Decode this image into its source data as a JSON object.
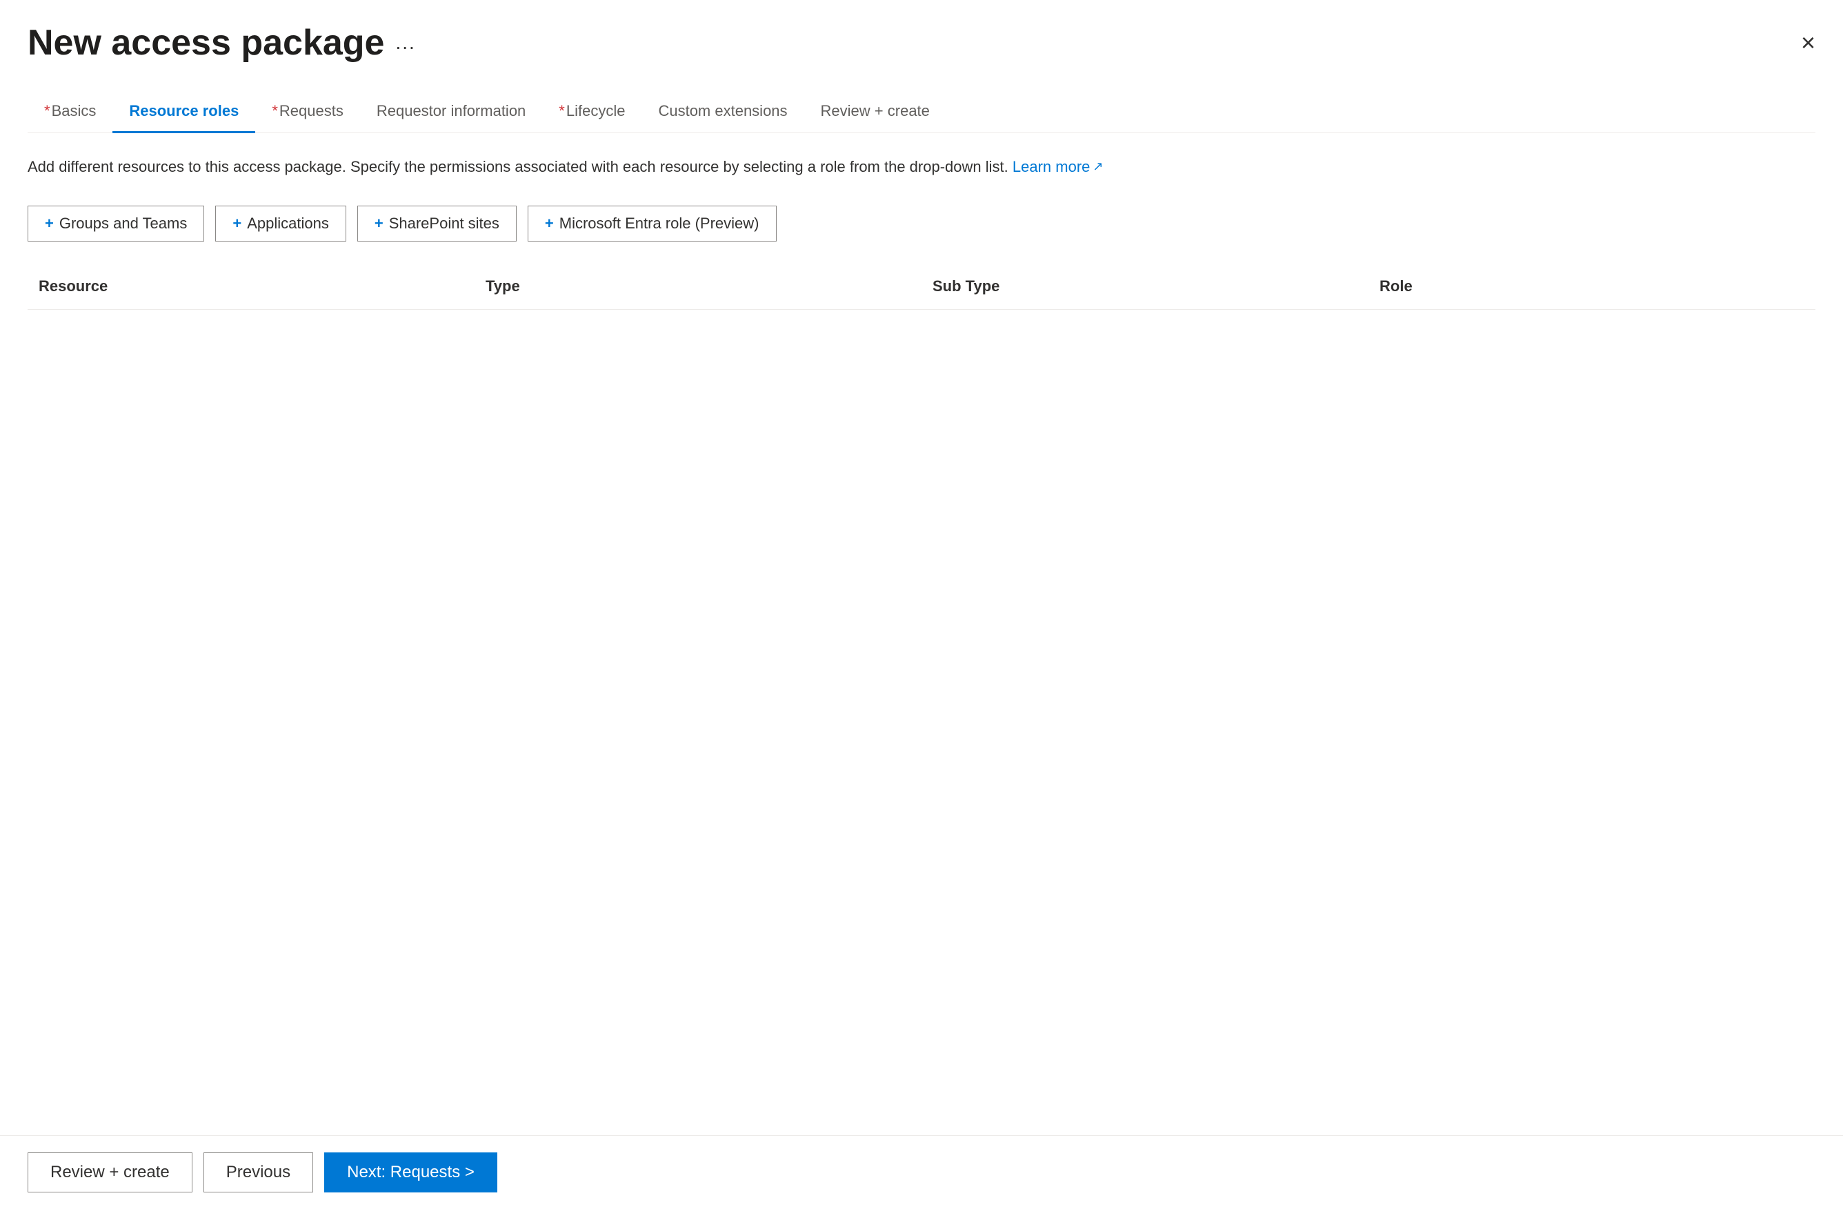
{
  "header": {
    "title": "New access package",
    "more_label": "...",
    "close_label": "×"
  },
  "tabs": [
    {
      "id": "basics",
      "label": "Basics",
      "required": true,
      "active": false
    },
    {
      "id": "resource-roles",
      "label": "Resource roles",
      "required": false,
      "active": true
    },
    {
      "id": "requests",
      "label": "Requests",
      "required": true,
      "active": false
    },
    {
      "id": "requestor-info",
      "label": "Requestor information",
      "required": false,
      "active": false
    },
    {
      "id": "lifecycle",
      "label": "Lifecycle",
      "required": true,
      "active": false
    },
    {
      "id": "custom-extensions",
      "label": "Custom extensions",
      "required": false,
      "active": false
    },
    {
      "id": "review-create",
      "label": "Review + create",
      "required": false,
      "active": false
    }
  ],
  "description": {
    "text": "Add different resources to this access package. Specify the permissions associated with each resource by selecting a role from the drop-down list.",
    "learn_more_label": "Learn more",
    "learn_more_icon": "↗"
  },
  "action_buttons": [
    {
      "id": "groups-teams",
      "label": "Groups and Teams",
      "plus": "+"
    },
    {
      "id": "applications",
      "label": "Applications",
      "plus": "+"
    },
    {
      "id": "sharepoint-sites",
      "label": "SharePoint sites",
      "plus": "+"
    },
    {
      "id": "entra-role",
      "label": "Microsoft Entra role (Preview)",
      "plus": "+"
    }
  ],
  "table": {
    "columns": [
      "Resource",
      "Type",
      "Sub Type",
      "Role"
    ]
  },
  "footer": {
    "review_create_label": "Review + create",
    "previous_label": "Previous",
    "next_label": "Next: Requests >"
  }
}
